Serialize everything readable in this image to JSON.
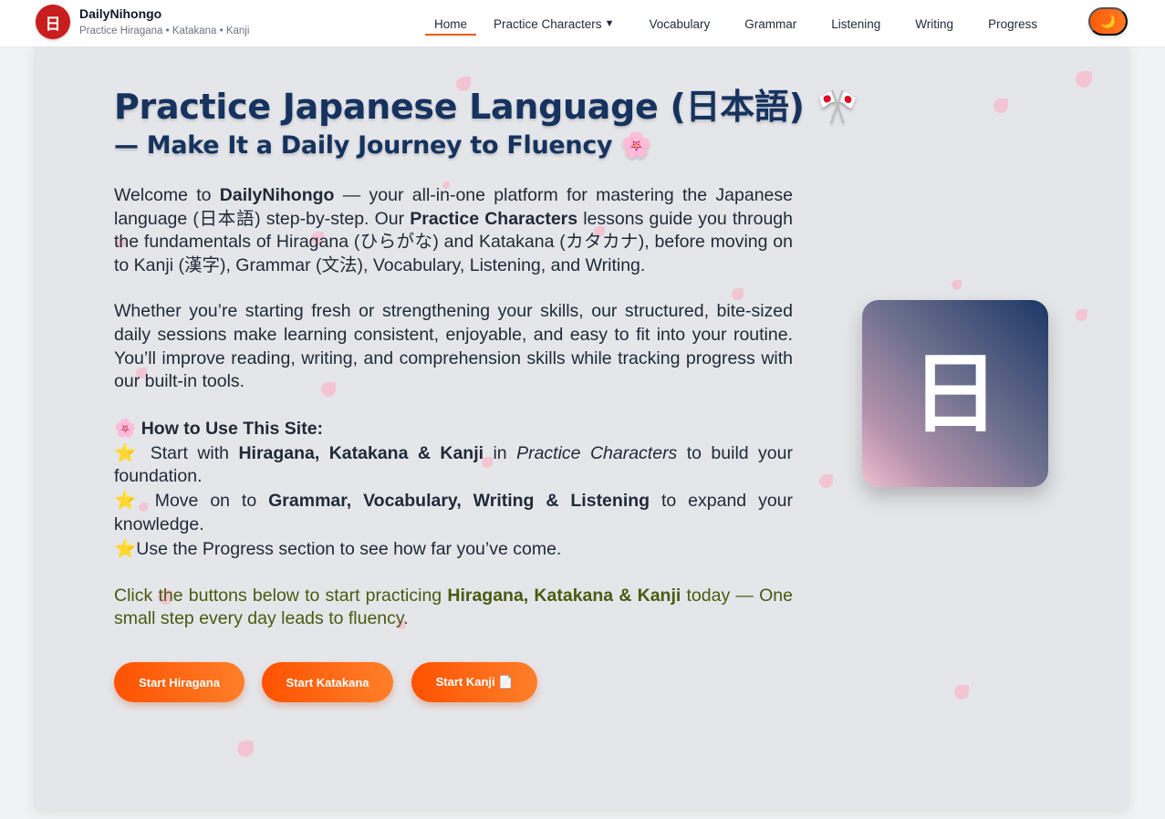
{
  "brand": {
    "logo_char": "日",
    "name": "DailyNihongo",
    "tagline": "Practice Hiragana • Katakana • Kanji"
  },
  "nav": {
    "home": "Home",
    "practice": "Practice Characters",
    "practice_caret": "▼",
    "vocabulary": "Vocabulary",
    "grammar": "Grammar",
    "listening": "Listening",
    "writing": "Writing",
    "progress": "Progress",
    "theme_icon": "moon-icon",
    "theme_glyph": "🌙"
  },
  "hero": {
    "title": "Practice Japanese Language (日本語)",
    "title_emoji": "🎌",
    "subtitle": "— Make It a Daily Journey to Fluency",
    "subtitle_emoji": "🌸",
    "p1": {
      "a": "Welcome to ",
      "b": "DailyNihongo",
      "c": " — your all-in-one platform for mastering the Japanese language (日本語) step-by-step. Our ",
      "d": "Practice Characters",
      "e": " lessons guide you through the fundamentals of Hiragana (ひらがな) and Katakana (カタカナ), before moving on to Kanji (漢字), Grammar (文法), Vocabulary, Listening, and Writing."
    },
    "p2": "Whether you’re starting fresh or strengthening your skills, our structured, bite-sized daily sessions make learning consistent, enjoyable, and easy to fit into your routine. You’ll improve reading, writing, and comprehension skills while tracking progress with our built-in tools.",
    "howto": {
      "heading_emoji": "🌸",
      "heading": "How to Use This Site:",
      "star": "⭐",
      "line1": {
        "a": " Start with ",
        "b": "Hiragana, Katakana & Kanji",
        "c": " in ",
        "d": "Practice Characters",
        "e": " to build your foundation."
      },
      "line2": {
        "a": " Move on to ",
        "b": "Grammar, Vocabulary, Writing & Listening",
        "c": " to expand your knowledge."
      },
      "line3": "Use the Progress section to see how far you’ve come."
    },
    "cta": {
      "a": "Click the buttons below to start practicing ",
      "b": "Hiragana, Katakana & Kanji",
      "c": " today — One small step every day leads to fluency."
    },
    "buttons": {
      "hiragana": "Start Hiragana",
      "katakana": "Start Katakana",
      "kanji": "Start Kanji 📄"
    },
    "card_char": "日"
  }
}
